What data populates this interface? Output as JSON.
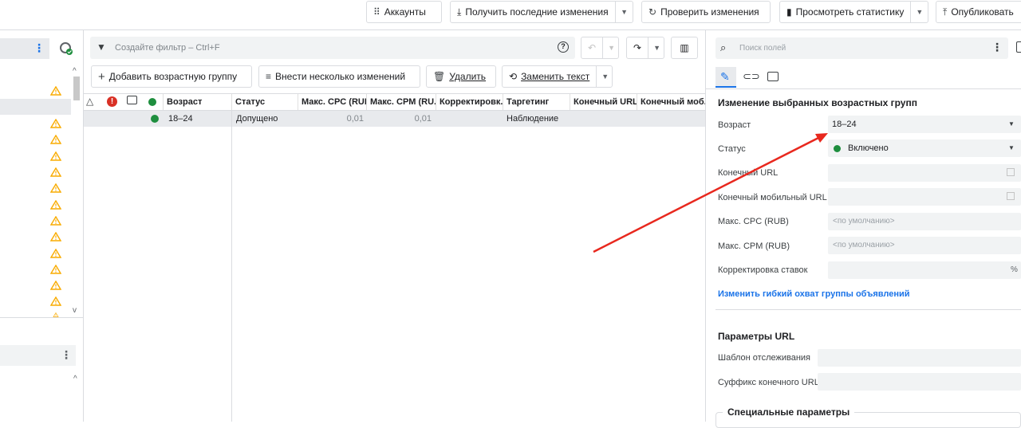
{
  "toolbar": {
    "accounts": "Аккаунты",
    "get_changes": "Получить последние изменения",
    "check_changes": "Проверить изменения",
    "view_stats": "Просмотреть статистику",
    "publish": "Опубликовать"
  },
  "filter": {
    "placeholder": "Создайте фильтр – Ctrl+F"
  },
  "actions": {
    "add_group": "Добавить возрастную группу",
    "bulk_changes": "Внести несколько изменений",
    "delete": "Удалить",
    "replace_text": "Заменить текст"
  },
  "table": {
    "headers": [
      "Возраст",
      "Статус",
      "Макс. CPC (RUB)",
      "Макс. CPM (RU...",
      "Корректировк...",
      "Таргетинг",
      "Конечный URL",
      "Конечный моб..."
    ],
    "row": {
      "age": "18–24",
      "status": "Допущено",
      "cpc": "0,01",
      "cpm": "0,01",
      "targeting": "Наблюдение"
    }
  },
  "panel": {
    "search_placeholder": "Поиск полей",
    "section_title": "Изменение выбранных возрастных групп",
    "fields": {
      "age_label": "Возраст",
      "age_value": "18–24",
      "status_label": "Статус",
      "status_value": "Включено",
      "final_url_label": "Конечный URL",
      "mobile_url_label": "Конечный мобильный URL",
      "cpc_label": "Макс. CPC (RUB)",
      "cpc_placeholder": "<по умолчанию>",
      "cpm_label": "Макс. CPM (RUB)",
      "cpm_placeholder": "<по умолчанию>",
      "bid_adj_label": "Корректировка ставок",
      "bid_adj_unit": "%"
    },
    "flex_link": "Изменить гибкий охват группы объявлений",
    "url_params_title": "Параметры URL",
    "tracking_label": "Шаблон отслеживания",
    "suffix_label": "Суффикс конечного URL",
    "special_title": "Специальные параметры"
  },
  "colors": {
    "accent": "#1a73e8",
    "green": "#1e8e3e",
    "warning": "#f9ab00",
    "error": "#d93025",
    "arrow": "#e8281e"
  }
}
